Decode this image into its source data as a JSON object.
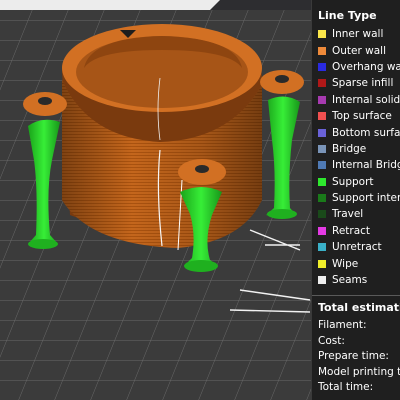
{
  "legend": {
    "title": "Line Type",
    "items": [
      {
        "label": "Inner wall",
        "color": "#fbe64a"
      },
      {
        "label": "Outer wall",
        "color": "#ee8a3a"
      },
      {
        "label": "Overhang wall",
        "color": "#2a2ae0"
      },
      {
        "label": "Sparse infill",
        "color": "#b01818"
      },
      {
        "label": "Internal solid infill",
        "color": "#a73ab0"
      },
      {
        "label": "Top surface",
        "color": "#f05050"
      },
      {
        "label": "Bottom surface",
        "color": "#6a62d8"
      },
      {
        "label": "Bridge",
        "color": "#7a94b8"
      },
      {
        "label": "Internal Bridge",
        "color": "#4f7ab5"
      },
      {
        "label": "Support",
        "color": "#2ee82e"
      },
      {
        "label": "Support interface",
        "color": "#1a7a1a"
      },
      {
        "label": "Travel",
        "color": "#1a4a1a"
      },
      {
        "label": "Retract",
        "color": "#e43ae4"
      },
      {
        "label": "Unretract",
        "color": "#3ab0c8"
      },
      {
        "label": "Wipe",
        "color": "#f0ee2a"
      },
      {
        "label": "Seams",
        "color": "#eeeeee"
      }
    ]
  },
  "estimation": {
    "title": "Total estimation",
    "items": [
      "Filament:",
      "Cost:",
      "Prepare time:",
      "Model printing time:",
      "Total time:"
    ]
  },
  "colors": {
    "model": "#c8681e",
    "support": "#2ee82e",
    "plate": "#3c3c3c",
    "grid": "#6c6c6c"
  }
}
